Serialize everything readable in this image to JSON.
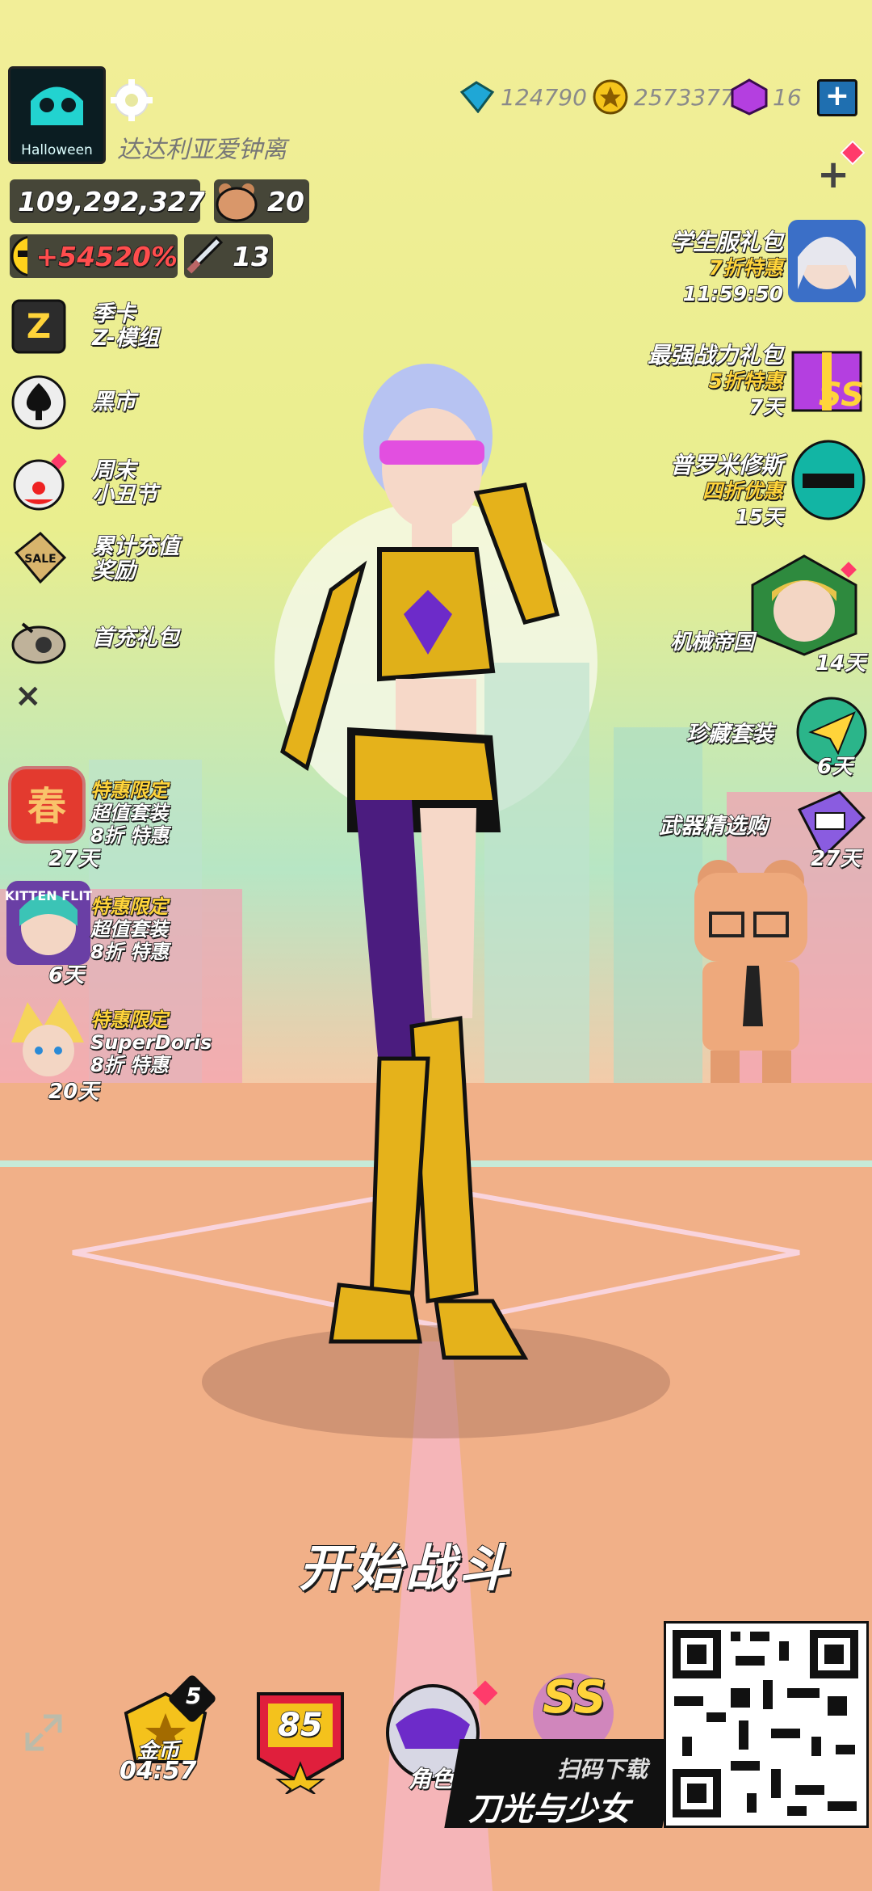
{
  "profile": {
    "avatar_label": "Halloween",
    "name": "达达利亚爱钟离"
  },
  "resources": {
    "gems": "124790",
    "gold": "2573377",
    "crystals": "16",
    "plus_label": "+"
  },
  "stats": {
    "trophies": "109,292,327",
    "pets": "20",
    "bonus": "+54520%",
    "weapons": "13"
  },
  "left_menu": [
    {
      "label_line1": "季卡",
      "label_line2": "Z-模组"
    },
    {
      "label_line1": "黑市",
      "label_line2": ""
    },
    {
      "label_line1": "周末",
      "label_line2": "小丑节"
    },
    {
      "label_line1": "累计充值",
      "label_line2": "奖励"
    },
    {
      "label_line1": "首充礼包",
      "label_line2": ""
    }
  ],
  "close_label": "×",
  "left_promos": [
    {
      "title": "特惠限定",
      "line2": "超值套装",
      "line3": "8折 特惠",
      "days": "27天",
      "icon_text": "春"
    },
    {
      "title": "特惠限定",
      "line2": "超值套装",
      "line3": "8折 特惠",
      "days": "6天",
      "icon_text": "KITTEN FLIT"
    },
    {
      "title": "特惠限定",
      "line2": "SuperDoris",
      "line3": "8折 特惠",
      "days": "20天",
      "icon_text": ""
    }
  ],
  "right_offers": [
    {
      "title": "学生服礼包",
      "sub": "7折特惠",
      "timer": "11:59:50"
    },
    {
      "title": "最强战力礼包",
      "sub": "5折特惠",
      "timer": "7天",
      "badge": "SS"
    },
    {
      "title": "普罗米修斯",
      "sub": "四折优惠",
      "timer": "15天"
    },
    {
      "title": "机械帝国",
      "sub": "",
      "timer": "14天"
    },
    {
      "title": "珍藏套装",
      "sub": "",
      "timer": "6天"
    },
    {
      "title": "武器精选购",
      "sub": "",
      "timer": "27天"
    }
  ],
  "start_button": "开始战斗",
  "bottom": {
    "gold_label": "金币",
    "gold_timer": "04:57",
    "gold_badge": "5",
    "level": "85",
    "character_label": "角色",
    "ss_label": "SS"
  },
  "watermark": {
    "scan_label": "扫码下载",
    "game_title": "刀光与少女"
  },
  "colors": {
    "sky_top": "#f2ee98",
    "ground": "#efa883",
    "accent_yellow": "#ffd43a",
    "bonus_red": "#ff4d4d"
  }
}
